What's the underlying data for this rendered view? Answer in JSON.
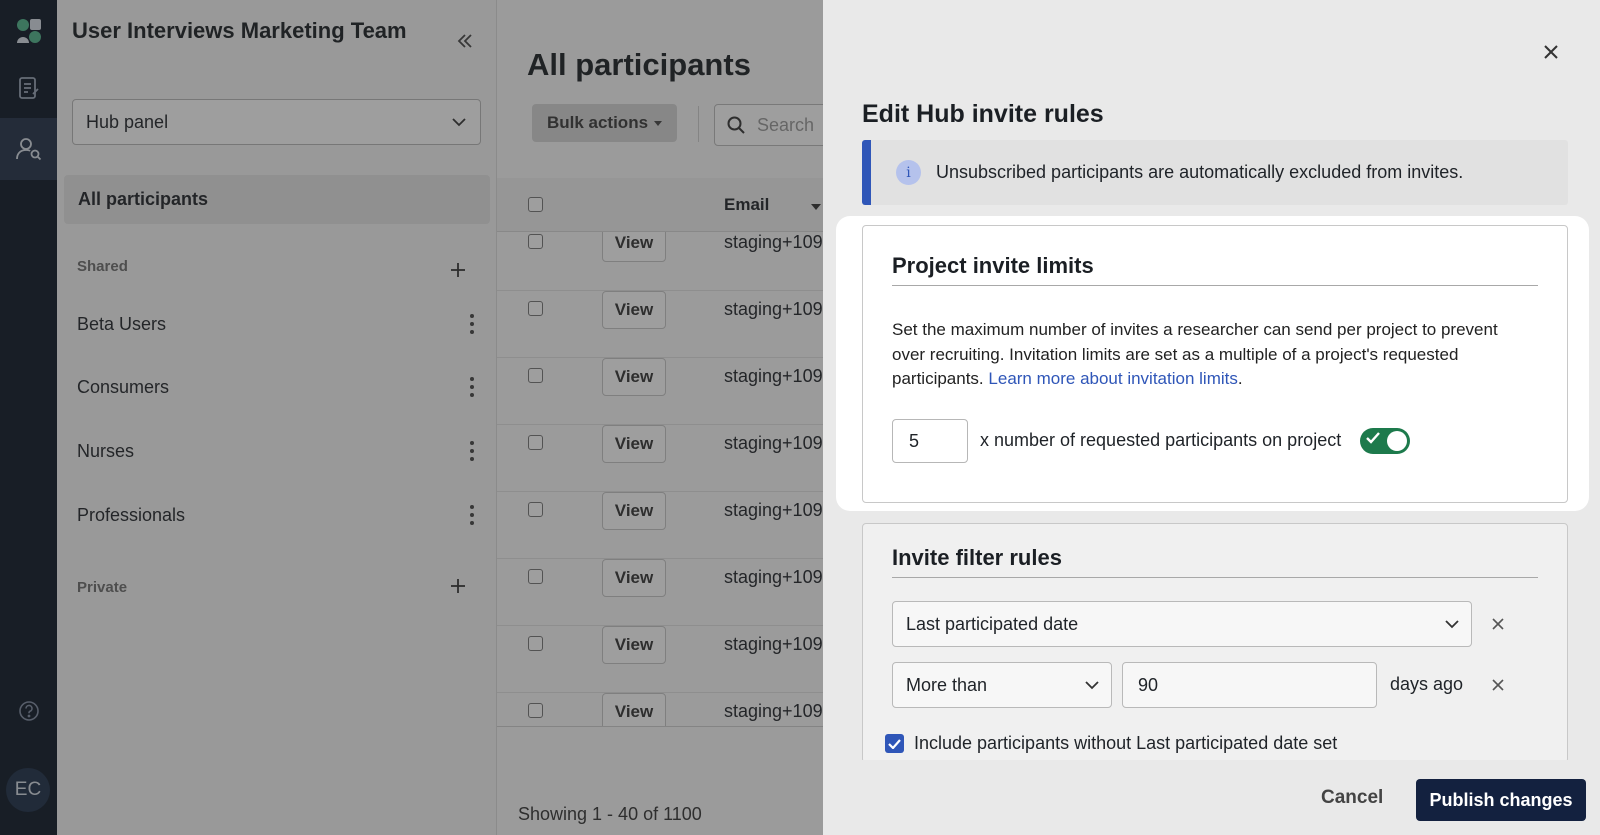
{
  "rail": {
    "avatar_initials": "EC",
    "icons": [
      "logo-icon",
      "notes-icon",
      "participants-icon",
      "help-icon"
    ]
  },
  "sidebar": {
    "team_title": "User Interviews Marketing Team",
    "panel_select_value": "Hub panel",
    "active_item": "All participants",
    "shared_label": "Shared",
    "private_label": "Private",
    "groups": [
      {
        "label": "Beta Users"
      },
      {
        "label": "Consumers"
      },
      {
        "label": "Nurses"
      },
      {
        "label": "Professionals"
      }
    ]
  },
  "main": {
    "title": "All participants",
    "bulk_actions_label": "Bulk actions",
    "search_placeholder": "Search",
    "email_header": "Email",
    "view_label": "View",
    "rows": [
      {
        "email": "staging+109"
      },
      {
        "email": "staging+109"
      },
      {
        "email": "staging+109"
      },
      {
        "email": "staging+109"
      },
      {
        "email": "staging+109"
      },
      {
        "email": "staging+109"
      },
      {
        "email": "staging+109"
      },
      {
        "email": "staging+109"
      }
    ],
    "pagination_text": "Showing 1 - 40 of 1100"
  },
  "drawer": {
    "title": "Edit Hub invite rules",
    "banner_text": "Unsubscribed participants are automatically excluded from invites.",
    "project_limits": {
      "title": "Project invite limits",
      "description": "Set the maximum number of invites a researcher can send per project to prevent over recruiting. Invitation limits are set as a multiple of a project's requested participants.",
      "link_text": "Learn more about invitation limits",
      "link_suffix": ".",
      "multiplier_value": "5",
      "multiplier_label": "x number of requested participants on project",
      "enabled": true
    },
    "filter_rules": {
      "title": "Invite filter rules",
      "rule_field": "Last participated date",
      "comparator": "More than",
      "days_value": "90",
      "days_suffix": "days ago",
      "include_without_label": "Include participants without Last participated date set",
      "include_without_checked": true
    },
    "cancel_label": "Cancel",
    "publish_label": "Publish changes"
  },
  "colors": {
    "accent_blue": "#2f56b8",
    "toggle_green": "#1d7a4c",
    "primary_button": "#13213f",
    "rail_bg": "#0b1626"
  }
}
